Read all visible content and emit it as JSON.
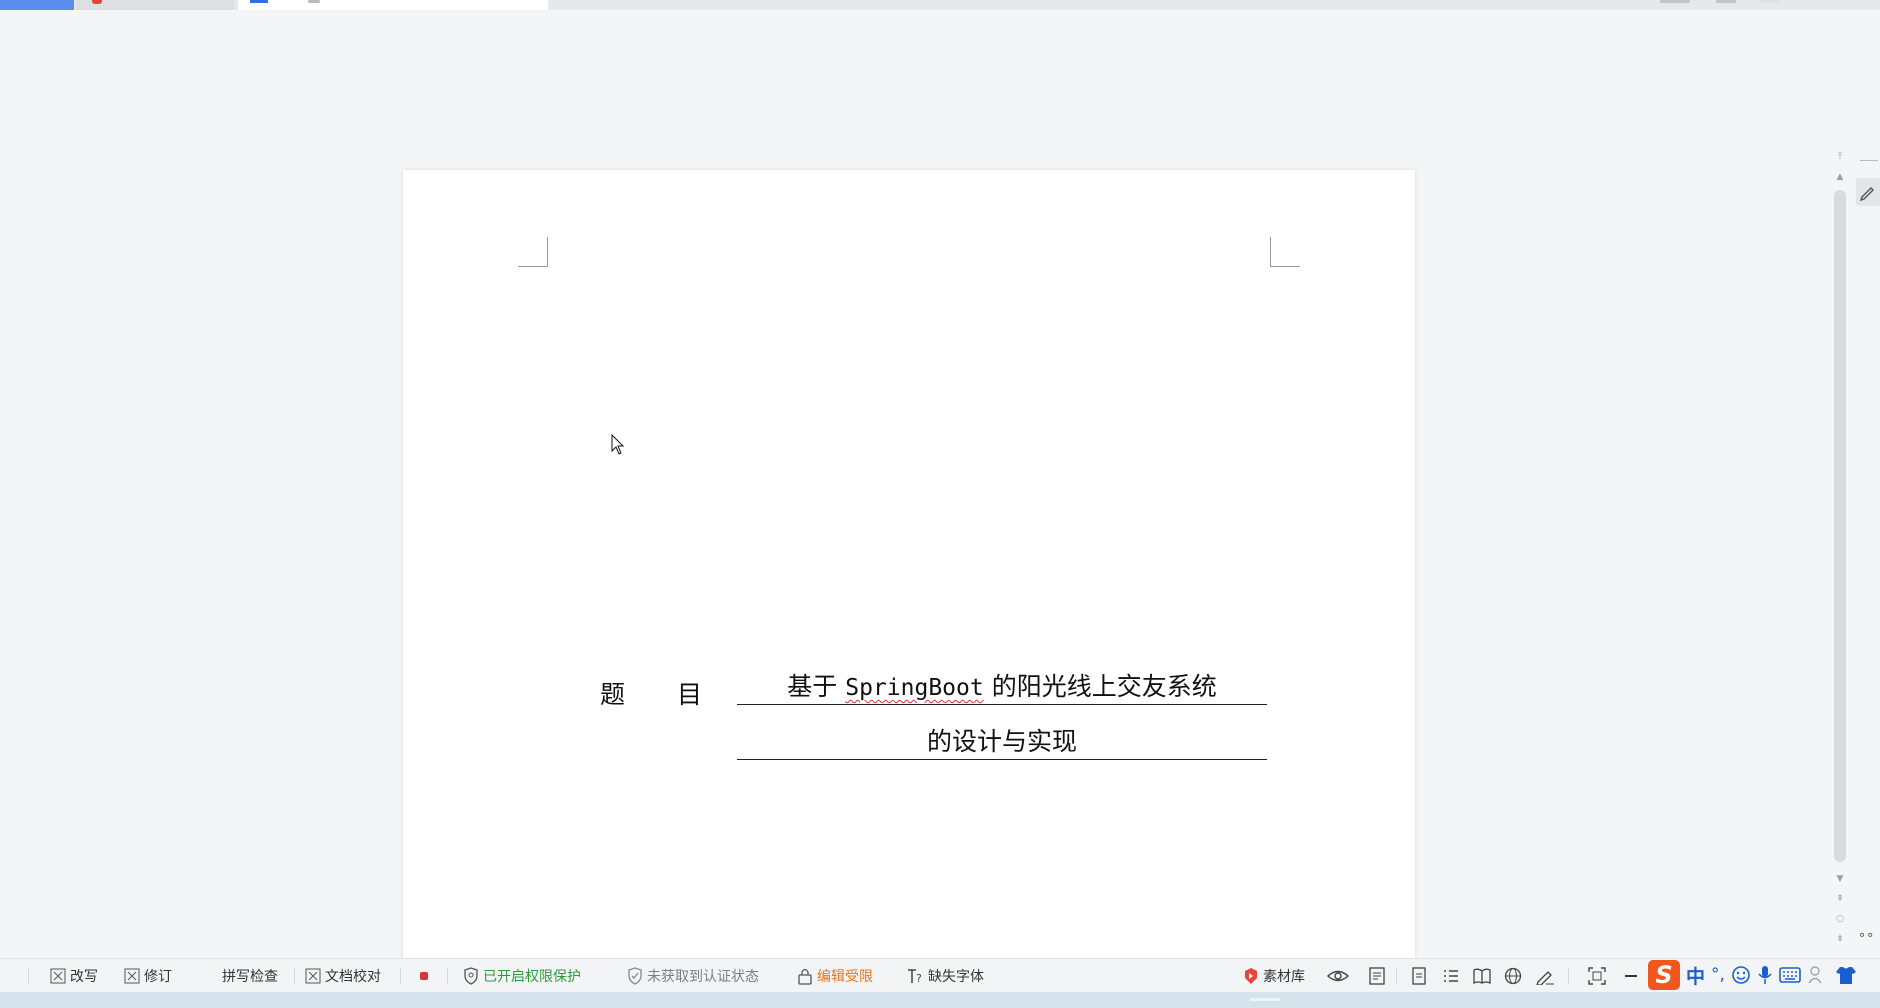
{
  "tabs": {
    "active_doc_marker": "doc-tab"
  },
  "document": {
    "title_label": "题 目",
    "title_line1_pre": "基于",
    "title_line1_spell": "SpringBoot",
    "title_line1_post": "的阳光线上交友系统",
    "title_line2": "的设计与实现"
  },
  "statusbar": {
    "overwrite": "改写",
    "revise": "修订",
    "spellcheck": "拼写检查",
    "doc_proof": "文档校对",
    "permission": "已开启权限保护",
    "cert": "未获取到认证状态",
    "edit_limit": "编辑受限",
    "missing_font": "缺失字体",
    "material": "素材库"
  },
  "ime": {
    "logo": "S",
    "lang": "中",
    "punct": "°,"
  },
  "colors": {
    "accent": "#2f6ee6",
    "green": "#2f9a3c",
    "orange": "#e8761f",
    "ime": "#f0561d"
  }
}
